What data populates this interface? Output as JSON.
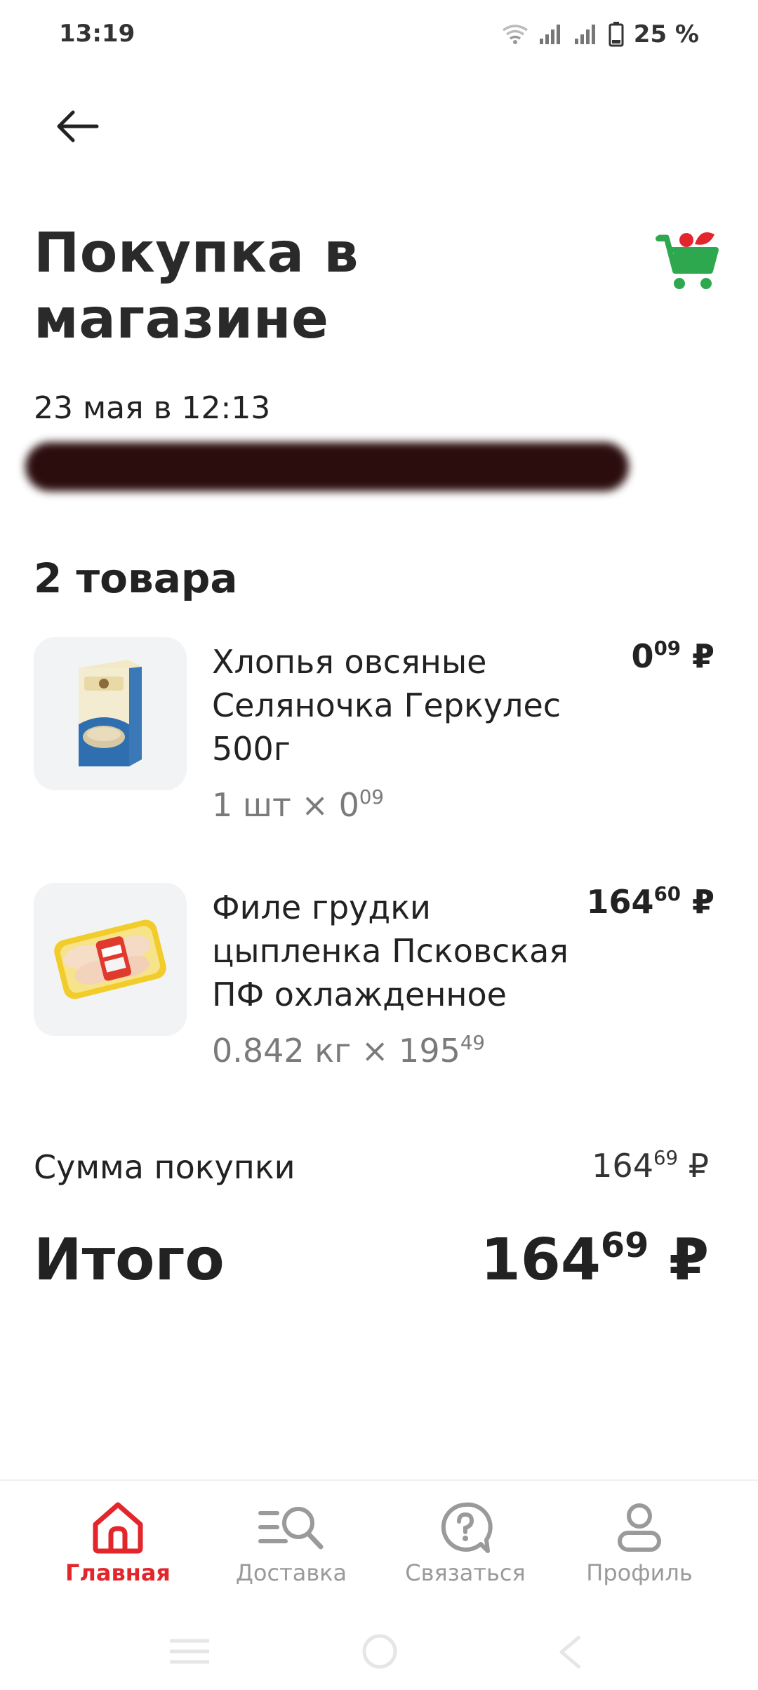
{
  "status_bar": {
    "time": "13:19",
    "battery": "25 %"
  },
  "header": {
    "title": "Покупка в магазине",
    "date": "23 мая в 12:13",
    "address": ""
  },
  "items_count": "2 товара",
  "products": [
    {
      "name": "Хлопья овсяные Селяночка Геркулес 500г",
      "qty_prefix": "1 шт × 0",
      "qty_cents": "09",
      "price_main": "0",
      "price_cents": "09",
      "currency": "₽"
    },
    {
      "name": "Филе грудки цыпленка Псковская ПФ охлажденное",
      "qty_prefix": "0.842 кг × 195",
      "qty_cents": "49",
      "price_main": "164",
      "price_cents": "60",
      "currency": "₽"
    }
  ],
  "summary": {
    "sum_label": "Сумма покупки",
    "sum_main": "164",
    "sum_cents": "69",
    "total_label": "Итого",
    "total_main": "164",
    "total_cents": "69",
    "currency": "₽"
  },
  "nav": {
    "home": "Главная",
    "delivery": "Доставка",
    "contact": "Связаться",
    "profile": "Профиль"
  },
  "colors": {
    "accent": "#e2262b",
    "cart_green": "#2ea84f",
    "inactive": "#9a9a9a"
  }
}
